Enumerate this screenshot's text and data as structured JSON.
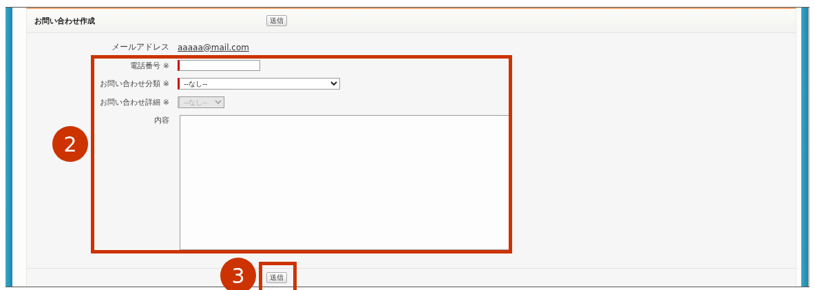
{
  "form": {
    "title": "お問い合わせ作成",
    "top_button": "送信",
    "fields": [
      {
        "kind": "static",
        "label": "メールアドレス",
        "value": "aaaaa@mail.com"
      },
      {
        "kind": "text",
        "label": "電話番号 ※",
        "required": true
      },
      {
        "kind": "select",
        "label": "お問い合わせ分類 ※",
        "value": "--なし--",
        "required": true,
        "disabled": false
      },
      {
        "kind": "select",
        "label": "お問い合わせ詳細 ※",
        "value": "--なし--",
        "required": false,
        "disabled": true
      },
      {
        "kind": "textarea",
        "label": "内容"
      }
    ],
    "bottom_button": "送信"
  },
  "callouts": [
    {
      "number": "2"
    },
    {
      "number": "3"
    }
  ]
}
